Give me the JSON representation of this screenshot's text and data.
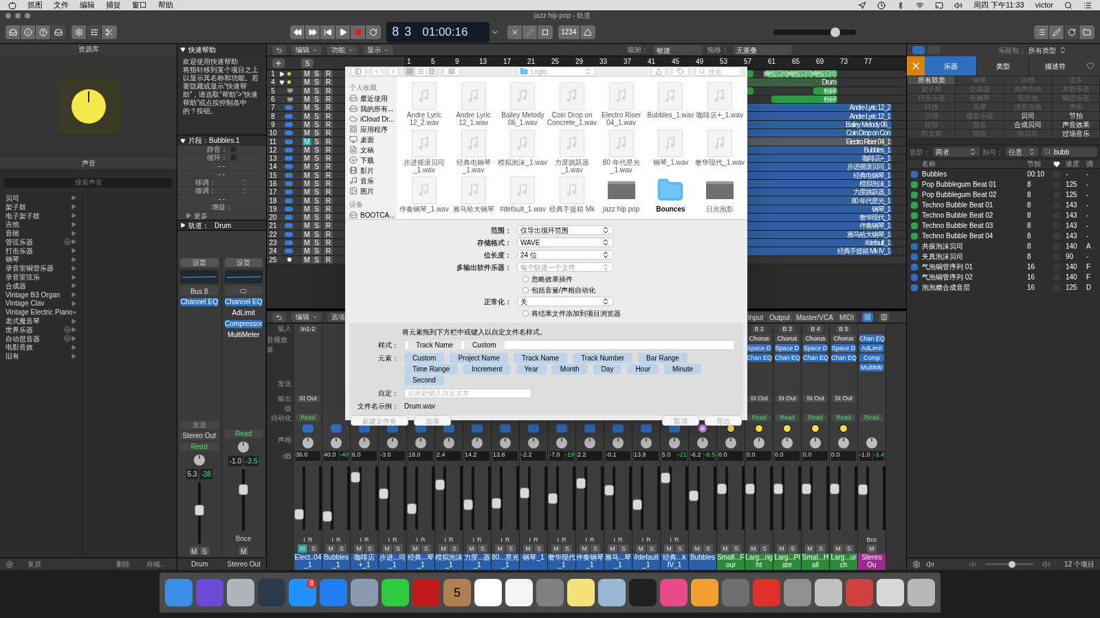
{
  "menu_bar": {
    "items": [
      "抓图",
      "文件",
      "编辑",
      "捕捉",
      "窗口",
      "帮助"
    ],
    "clock": "周四 下午11:33",
    "user": "victor"
  },
  "window": {
    "title": "jazz hip pop - 轨道"
  },
  "transport": {
    "bar": "8",
    "beat": "3",
    "time": "01:00:16",
    "count_in": "1234"
  },
  "zoom_slider": {
    "level": 0.75
  },
  "library": {
    "title": "资源库",
    "section": "声音",
    "search_placeholder": "搜索声音",
    "categories": [
      {
        "label": "贝司",
        "download": false
      },
      {
        "label": "架子鼓",
        "download": false
      },
      {
        "label": "电子架子鼓",
        "download": false
      },
      {
        "label": "吉他",
        "download": false
      },
      {
        "label": "音槌",
        "download": false
      },
      {
        "label": "管弦乐器",
        "download": true
      },
      {
        "label": "打击乐器",
        "download": false
      },
      {
        "label": "钢琴",
        "download": false
      },
      {
        "label": "录音室铜管乐器",
        "download": false
      },
      {
        "label": "录音室弦乐",
        "download": false
      },
      {
        "label": "合成器",
        "download": false
      },
      {
        "label": "Vintage B3 Organ",
        "download": false
      },
      {
        "label": "Vintage Clav",
        "download": false
      },
      {
        "label": "Vintage Electric Piano",
        "download": false
      },
      {
        "label": "老式魔音琴",
        "download": false
      },
      {
        "label": "世界乐器",
        "download": true
      },
      {
        "label": "自动琶音器",
        "download": true
      },
      {
        "label": "电影音效",
        "download": false
      },
      {
        "label": "旧有",
        "download": false
      }
    ],
    "buttons": [
      "复原",
      "删除",
      "存储..."
    ]
  },
  "quick_help": {
    "title": "快速帮助",
    "heading": "欢迎使用快速帮助",
    "body": "将指针移到某个项目之上以显示其名称和功能。若要隐藏或显示“快速帮助”，请选取“帮助”>“快速帮助”或点按控制条中的？按钮。"
  },
  "region_inspector": {
    "title": "片段：Bubbles.1",
    "fields": [
      {
        "kind": "check",
        "label": "静音：",
        "checked": false
      },
      {
        "kind": "check",
        "label": "循环：",
        "checked": false
      },
      {
        "kind": "value",
        "value": "- -"
      },
      {
        "kind": "value",
        "value": "- -"
      },
      {
        "kind": "stepper",
        "label": "移调："
      },
      {
        "kind": "stepper",
        "label": "微调："
      },
      {
        "kind": "value",
        "value": "- -"
      },
      {
        "kind": "label",
        "label": "增益："
      }
    ],
    "more": "更多"
  },
  "track_inspector": {
    "title": "轨道：",
    "name": "Drum"
  },
  "inspector_strips": [
    {
      "setting": "设置",
      "input": "Bus 8",
      "plugins": [
        "Channel EQ"
      ],
      "send": "发送",
      "output": "Stereo Out",
      "automation": "Read",
      "db": "5.3",
      "peak": "-38",
      "level": 0.55,
      "mute_label": "M",
      "solo_label": "S",
      "name": "Drum"
    },
    {
      "setting": "设置",
      "plugins": [
        "Channel EQ",
        "AdLimit",
        "Compressor",
        "MultiMeter"
      ],
      "automation": "Read",
      "db": "-1.0",
      "peak": "-3.5",
      "level": 0.7,
      "bounce": "Bnce",
      "mute_label": "M",
      "name": "Stereo Out"
    }
  ],
  "tracks_toolbar": {
    "menus": [
      "编辑",
      "功能",
      "显示"
    ],
    "solo_label": "S",
    "snap_label": "吸附：",
    "snap": "敏捷",
    "drag_label": "拖移：",
    "drag": "无重叠"
  },
  "ruler": [
    "1",
    "5",
    "9",
    "13",
    "17",
    "21",
    "25",
    "29",
    "33",
    "37",
    "41",
    "45",
    "49",
    "53",
    "57",
    "61",
    "65",
    "69",
    "73",
    "77"
  ],
  "tracks": [
    {
      "number": "1",
      "kind": "stack",
      "expanded": false,
      "muted": false,
      "mute_label": "M",
      "solo_label": "S",
      "record_label": "R",
      "regions": [
        {
          "color": "#2e9a44"
        },
        {
          "name": "拇指贝司",
          "color": "#2e9a44"
        },
        {
          "name": "拇指贝司",
          "color": "#2e9a44"
        },
        {
          "name": "拇指贝司",
          "color": "#2e9a44"
        }
      ]
    },
    {
      "number": "4",
      "kind": "stack",
      "expanded": true,
      "muted": false,
      "mute_label": "M",
      "solo_label": "S",
      "record_label": "R",
      "regions": [
        {
          "name": "Drum",
          "color": "#3f5f45"
        }
      ]
    },
    {
      "number": "5",
      "kind": "drum",
      "muted": false,
      "mute_label": "M",
      "solo_label": "S",
      "record_label": "R",
      "regions": [
        {
          "color": "#2e9a44"
        },
        {
          "name": "粉碎",
          "color": "#2e9a44"
        }
      ]
    },
    {
      "number": "6",
      "kind": "drum",
      "muted": false,
      "mute_label": "M",
      "solo_label": "S",
      "record_label": "R",
      "regions": [
        {
          "name": "粉碎",
          "color": "#2e9a44"
        }
      ]
    },
    {
      "number": "7",
      "kind": "audio",
      "muted": false,
      "mute_label": "M",
      "solo_label": "S",
      "record_label": "R",
      "regions": [
        {
          "name": "Andre Lyric 12_2",
          "color": "#2f5f9e"
        }
      ]
    },
    {
      "number": "8",
      "kind": "audio",
      "muted": false,
      "mute_label": "M",
      "solo_label": "S",
      "record_label": "R",
      "regions": [
        {
          "name": "Andre Lyric 12_1",
          "color": "#2f5f9e"
        }
      ]
    },
    {
      "number": "9",
      "kind": "audio",
      "muted": false,
      "mute_label": "M",
      "solo_label": "S",
      "record_label": "R",
      "regions": [
        {
          "name": "Bailey Melody 06_",
          "color": "#2f5f9e"
        }
      ]
    },
    {
      "number": "10",
      "kind": "audio",
      "muted": false,
      "mute_label": "M",
      "solo_label": "S",
      "record_label": "R",
      "regions": [
        {
          "name": "Coin Drop on Con",
          "color": "#2f5f9e"
        }
      ]
    },
    {
      "number": "11",
      "kind": "audio",
      "muted": true,
      "mute_label": "M",
      "solo_label": "S",
      "record_label": "R",
      "regions": [
        {
          "name": "Electro Riser 04_1",
          "color": "#555a60"
        }
      ]
    },
    {
      "number": "12",
      "kind": "audio",
      "muted": false,
      "mute_label": "M",
      "solo_label": "S",
      "record_label": "R",
      "regions": [
        {
          "name": "Bubbles_1",
          "color": "#2f5f9e"
        }
      ]
    },
    {
      "number": "13",
      "kind": "audio",
      "muted": false,
      "mute_label": "M",
      "solo_label": "S",
      "record_label": "R",
      "regions": [
        {
          "name": "咖啡店+_1",
          "color": "#2f5f9e"
        }
      ]
    },
    {
      "number": "14",
      "kind": "audio",
      "muted": false,
      "mute_label": "M",
      "solo_label": "S",
      "record_label": "R",
      "regions": [
        {
          "name": "步进摇滚贝司_1",
          "color": "#2f5f9e"
        }
      ]
    },
    {
      "number": "15",
      "kind": "audio",
      "muted": false,
      "mute_label": "M",
      "solo_label": "S",
      "record_label": "R",
      "regions": [
        {
          "name": "经典电钢琴_1",
          "color": "#2f5f9e"
        }
      ]
    },
    {
      "number": "16",
      "kind": "audio",
      "muted": false,
      "mute_label": "M",
      "solo_label": "S",
      "record_label": "R",
      "regions": [
        {
          "name": "模拟泡沫_1",
          "color": "#2f5f9e"
        }
      ]
    },
    {
      "number": "17",
      "kind": "audio",
      "muted": false,
      "mute_label": "M",
      "solo_label": "S",
      "record_label": "R",
      "regions": [
        {
          "name": "力度跳跃器_1",
          "color": "#2f5f9e"
        }
      ]
    },
    {
      "number": "18",
      "kind": "audio",
      "muted": false,
      "mute_label": "M",
      "solo_label": "S",
      "record_label": "R",
      "regions": [
        {
          "name": "80 年代星光_1",
          "color": "#2f5f9e"
        }
      ]
    },
    {
      "number": "19",
      "kind": "audio",
      "muted": false,
      "mute_label": "M",
      "solo_label": "S",
      "record_label": "R",
      "regions": [
        {
          "name": "钢琴_1",
          "color": "#2f5f9e"
        }
      ]
    },
    {
      "number": "20",
      "kind": "audio",
      "muted": false,
      "mute_label": "M",
      "solo_label": "S",
      "record_label": "R",
      "regions": [
        {
          "name": "奢华现代_1",
          "color": "#2f5f9e"
        }
      ]
    },
    {
      "number": "21",
      "kind": "audio",
      "muted": false,
      "mute_label": "M",
      "solo_label": "S",
      "record_label": "R",
      "regions": [
        {
          "name": "伴奏钢琴_1",
          "color": "#2f5f9e"
        }
      ]
    },
    {
      "number": "22",
      "kind": "audio",
      "muted": false,
      "mute_label": "M",
      "solo_label": "S",
      "record_label": "R",
      "regions": [
        {
          "name": "雅马哈大钢琴_1",
          "color": "#2f5f9e"
        }
      ]
    },
    {
      "number": "23",
      "kind": "audio",
      "muted": false,
      "mute_label": "M",
      "solo_label": "S",
      "record_label": "R",
      "regions": [
        {
          "name": "#default_1",
          "color": "#2f5f9e"
        }
      ]
    },
    {
      "number": "24",
      "kind": "audio",
      "muted": false,
      "mute_label": "M",
      "solo_label": "S",
      "record_label": "R",
      "regions": [
        {
          "name": "经典手提箱 Mk IV_1",
          "color": "#2f5f9e"
        }
      ]
    },
    {
      "number": "25",
      "kind": "instrument",
      "muted": false,
      "mute_label": "M",
      "solo_label": "S",
      "record_label": "R"
    }
  ],
  "mixer": {
    "menus": [
      "编辑",
      "选项"
    ],
    "tabs": [
      {
        "label": "Input",
        "selected": false
      },
      {
        "label": "Output",
        "selected": false
      },
      {
        "label": "Master/VCA",
        "selected": false
      },
      {
        "label": "MIDI",
        "selected": false
      }
    ],
    "row_labels": [
      "输入",
      "音频效果",
      "发送",
      "输出",
      "组",
      "自动化",
      "声相",
      "dB"
    ],
    "strips": [
      {
        "kind": "audio",
        "name": "Elect..04_1",
        "color": "#2a5ea8",
        "input": "In1-2",
        "output": "St Out",
        "automation": "Read",
        "db": "36.0",
        "level": 0.2,
        "muted": true,
        "input_label": "I",
        "record_label": "R",
        "mute_label": "M",
        "solo_label": "S"
      },
      {
        "kind": "audio",
        "name": "Bubbles_1",
        "color": "#2a5ea8",
        "db": "40.0",
        "peak": "-40",
        "level": 0.15,
        "muted": false,
        "input_label": "I",
        "record_label": "R",
        "mute_label": "M",
        "solo_label": "S"
      },
      {
        "kind": "audio",
        "name": "咖啡店+_1",
        "color": "#2a5ea8",
        "db": "6.0",
        "level": 0.9,
        "muted": false,
        "input_label": "I",
        "record_label": "R",
        "mute_label": "M",
        "solo_label": "S"
      },
      {
        "kind": "audio",
        "name": "步进...司_1",
        "color": "#2a5ea8",
        "db": "-3.0",
        "level": 0.58,
        "muted": false,
        "input_label": "I",
        "record_label": "R",
        "mute_label": "M",
        "solo_label": "S"
      },
      {
        "kind": "audio",
        "name": "经典...琴_1",
        "color": "#2a5ea8",
        "db": "18.0",
        "level": 0.3,
        "muted": false,
        "input_label": "I",
        "record_label": "R",
        "mute_label": "M",
        "solo_label": "S"
      },
      {
        "kind": "audio",
        "name": "模拟泡沫_1",
        "color": "#2a5ea8",
        "db": "2.4",
        "level": 0.75,
        "muted": false,
        "input_label": "I",
        "record_label": "R",
        "mute_label": "M",
        "solo_label": "S"
      },
      {
        "kind": "audio",
        "name": "力度...器_1",
        "color": "#2a5ea8",
        "db": "14.2",
        "level": 0.38,
        "muted": false,
        "input_label": "I",
        "record_label": "R",
        "mute_label": "M",
        "solo_label": "S"
      },
      {
        "kind": "audio",
        "name": "80...星光_1",
        "color": "#2a5ea8",
        "db": "13.8",
        "level": 0.4,
        "muted": false,
        "input_label": "I",
        "record_label": "R",
        "mute_label": "M",
        "solo_label": "S"
      },
      {
        "kind": "audio",
        "name": "钢琴_1",
        "color": "#2a5ea8",
        "db": "-2.2",
        "level": 0.6,
        "muted": false,
        "input_label": "I",
        "record_label": "R",
        "mute_label": "M",
        "solo_label": "S"
      },
      {
        "kind": "audio",
        "name": "奢华现代_1",
        "color": "#2a5ea8",
        "db": "-7.0",
        "peak": "-19",
        "level": 0.5,
        "muted": false,
        "input_label": "I",
        "record_label": "R",
        "mute_label": "M",
        "solo_label": "S"
      },
      {
        "kind": "audio",
        "name": "伴奏钢琴_1",
        "color": "#2a5ea8",
        "db": "2.2",
        "level": 0.78,
        "muted": false,
        "input_label": "I",
        "record_label": "R",
        "mute_label": "M",
        "solo_label": "S"
      },
      {
        "kind": "audio",
        "name": "雅马...琴_1",
        "color": "#2a5ea8",
        "db": "-0.1",
        "level": 0.65,
        "muted": false,
        "input_label": "I",
        "record_label": "R",
        "mute_label": "M",
        "solo_label": "S"
      },
      {
        "kind": "audio",
        "name": "#default_1",
        "color": "#2a5ea8",
        "db": "13.8",
        "level": 0.38,
        "muted": false,
        "input_label": "I",
        "record_label": "R",
        "mute_label": "M",
        "solo_label": "S"
      },
      {
        "kind": "audio",
        "name": "经典...k IV_1",
        "color": "#2a5ea8",
        "db": "5.0",
        "peak": "-21",
        "level": 0.88,
        "muted": false,
        "input_label": "I",
        "record_label": "R",
        "mute_label": "M",
        "solo_label": "S"
      },
      {
        "kind": "instrument",
        "name": "Bubbles",
        "color": "#2a5ea8",
        "db": "-6.2",
        "peak": "-6.5",
        "level": 0.55,
        "muted": false,
        "mute_label": "M",
        "solo_label": "S"
      },
      {
        "kind": "aux",
        "name": "Small...Four",
        "color": "#2d8a3a",
        "db": "0.0",
        "level": 0.68,
        "muted": false,
        "mute_label": "M",
        "solo_label": "S"
      },
      {
        "kind": "aux",
        "name": "Larg...right",
        "color": "#2d8a3a",
        "input": "B 2",
        "plugins": [
          "Chorus",
          "Space D",
          "Chan EQ"
        ],
        "output": "St Out",
        "automation": "Read",
        "db": "0.0",
        "level": 0.68,
        "muted": false,
        "mute_label": "M",
        "solo_label": "S"
      },
      {
        "kind": "aux",
        "name": "Larg...Plate",
        "color": "#2d8a3a",
        "input": "B 3",
        "plugins": [
          "Chorus",
          "Space D",
          "Chan EQ"
        ],
        "output": "St Out",
        "automation": "Read",
        "db": "0.0",
        "level": 0.68,
        "muted": false,
        "mute_label": "M",
        "solo_label": "S"
      },
      {
        "kind": "aux",
        "name": "Smal...Hall",
        "color": "#2d8a3a",
        "input": "B 4",
        "plugins": [
          "Chorus",
          "Space D",
          "Chan EQ"
        ],
        "output": "St Out",
        "automation": "Read",
        "db": "0.0",
        "level": 0.68,
        "muted": false,
        "mute_label": "M",
        "solo_label": "S"
      },
      {
        "kind": "aux",
        "name": "Larg...urch",
        "color": "#2d8a3a",
        "input": "B 5",
        "plugins": [
          "Chorus",
          "Space D",
          "Chan EQ"
        ],
        "output": "St Out",
        "automation": "Read",
        "db": "0.0",
        "level": 0.68,
        "muted": false,
        "mute_label": "M",
        "solo_label": "S"
      },
      {
        "kind": "master",
        "name": "Stereo Ou",
        "color": "#9a2a8e",
        "plugins": [
          "Chan EQ",
          "AdLimit",
          "Comp",
          "MultiMtr"
        ],
        "automation": "Read",
        "db": "-1.0",
        "peak": "-3.4",
        "level": 0.66,
        "muted": false,
        "bounce": "Bnc",
        "mute_label": "M"
      }
    ]
  },
  "export_dialog": {
    "location": "Logic",
    "search_placeholder": "搜索",
    "sidebar": [
      {
        "heading": "个人收藏",
        "items": [
          {
            "label": "最近使用",
            "kind": "drive"
          },
          {
            "label": "我的所有...",
            "kind": "drive"
          },
          {
            "label": "iCloud Dr...",
            "kind": "cloud"
          },
          {
            "label": "应用程序",
            "kind": "apps"
          },
          {
            "label": "桌面",
            "kind": "desktop"
          },
          {
            "label": "文稿",
            "kind": "docs"
          },
          {
            "label": "下载",
            "kind": "download"
          },
          {
            "label": "影片",
            "kind": "film"
          },
          {
            "label": "音乐",
            "kind": "music"
          },
          {
            "label": "图片",
            "kind": "photo"
          }
        ]
      },
      {
        "heading": "设备",
        "items": [
          {
            "label": "BOOTCA...",
            "kind": "drive"
          }
        ]
      }
    ],
    "files": [
      {
        "name": "Andre Lyric 12_2.wav",
        "kind": "audio"
      },
      {
        "name": "Andre Lyric 12_1.wav",
        "kind": "audio"
      },
      {
        "name": "Bailey Melody 06_1.wav",
        "kind": "audio"
      },
      {
        "name": "Coin Drop on Concrete_1.wav",
        "kind": "audio"
      },
      {
        "name": "Electro Riser 04_1.wav",
        "kind": "audio"
      },
      {
        "name": "Bubbles_1.wav",
        "kind": "audio"
      },
      {
        "name": "咖啡店+_1.wav",
        "kind": "audio"
      },
      {
        "name": "步进摇滚贝司_1.wav",
        "kind": "audio"
      },
      {
        "name": "经典电钢琴_1.wav",
        "kind": "audio"
      },
      {
        "name": "模拟泡沫_1.wav",
        "kind": "audio"
      },
      {
        "name": "力度跳跃器_1.wav",
        "kind": "audio"
      },
      {
        "name": "80 年代星光_1.wav",
        "kind": "audio"
      },
      {
        "name": "钢琴_1.wav",
        "kind": "audio"
      },
      {
        "name": "奢华现代_1.wav",
        "kind": "audio"
      },
      {
        "name": "伴奏钢琴_1.wav",
        "kind": "audio"
      },
      {
        "name": "雅马哈大钢琴",
        "kind": "audio"
      },
      {
        "name": "#default_1.wav",
        "kind": "audio"
      },
      {
        "name": "经典手提箱 Mk",
        "kind": "audio"
      },
      {
        "name": "jazz hip pop",
        "kind": "project"
      },
      {
        "name": "Bounces",
        "kind": "folder"
      },
      {
        "name": "日光泡影",
        "kind": "project"
      }
    ],
    "options": [
      {
        "kind": "select",
        "label": "范围：",
        "value": "仅导出循环范围",
        "disabled": false
      },
      {
        "kind": "select",
        "label": "存储格式：",
        "value": "WAVE",
        "disabled": false
      },
      {
        "kind": "select",
        "label": "位长度：",
        "value": "24 位",
        "disabled": false
      },
      {
        "kind": "select",
        "label": "多输出软件乐器：",
        "value": "每个轨道一个文件",
        "disabled": true
      },
      {
        "kind": "check",
        "label": "忽略效果插件",
        "checked": false
      },
      {
        "kind": "check",
        "label": "包括音量/声相自动化",
        "checked": false
      },
      {
        "kind": "select",
        "label": "正常化：",
        "value": "关",
        "disabled": false
      },
      {
        "kind": "check",
        "label": "将结果文件添加到项目浏览器",
        "checked": false
      }
    ],
    "naming": {
      "hint": "将元素拖到下方栏中或键入以自定文件名样式。",
      "style_label": "样式：",
      "style_tokens": [
        "Track Name",
        "Custom"
      ],
      "elements_label": "元素：",
      "elements": [
        "Custom",
        "Project Name",
        "Track Name",
        "Track Number",
        "Bar Range",
        "Time Range",
        "Increment",
        "Year",
        "Month",
        "Day",
        "Hour",
        "Minute",
        "Second"
      ],
      "custom_label": "自定：",
      "custom_placeholder": "在此处键入自定文本",
      "example_label": "文件名示例：",
      "example": "Drum.wav"
    },
    "buttons": [
      {
        "label": "新建文件夹",
        "disabled": true
      },
      {
        "label": "选项",
        "disabled": true
      },
      {
        "label": "取消",
        "disabled": true
      },
      {
        "label": "导出",
        "disabled": true
      }
    ]
  },
  "loop_browser": {
    "pack_label": "乐段包：",
    "pack": "所有类型",
    "tabs": [
      {
        "label": "乐器",
        "selected": true
      },
      {
        "label": "类型",
        "selected": false
      },
      {
        "label": "描述符",
        "selected": false
      }
    ],
    "keywords": [
      {
        "label": "所有鼓类",
        "disabled": false,
        "selected": true
      },
      {
        "label": "钢琴",
        "disabled": true,
        "selected": false
      },
      {
        "label": "吉他",
        "disabled": true,
        "selected": false
      },
      {
        "label": "弦乐",
        "disabled": true,
        "selected": false
      },
      {
        "label": "架子鼓",
        "disabled": true,
        "selected": false
      },
      {
        "label": "合成器",
        "disabled": true,
        "selected": false
      },
      {
        "label": "原声吉他",
        "disabled": true,
        "selected": false
      },
      {
        "label": "木管乐器",
        "disabled": true,
        "selected": false
      },
      {
        "label": "打击乐器",
        "disabled": true,
        "selected": false
      },
      {
        "label": "电钢琴",
        "disabled": true,
        "selected": false
      },
      {
        "label": "电吉他",
        "disabled": true,
        "selected": false
      },
      {
        "label": "铜管乐器",
        "disabled": true,
        "selected": false
      },
      {
        "label": "特效",
        "disabled": true,
        "selected": false
      },
      {
        "label": "风琴",
        "disabled": true,
        "selected": false
      },
      {
        "label": "清音吉他",
        "disabled": true,
        "selected": false
      },
      {
        "label": "声乐",
        "disabled": true,
        "selected": false
      },
      {
        "label": "沙锤",
        "disabled": true,
        "selected": false
      },
      {
        "label": "键盘乐器",
        "disabled": true,
        "selected": false
      },
      {
        "label": "贝司",
        "disabled": false,
        "selected": false
      },
      {
        "label": "节拍",
        "disabled": false,
        "selected": false
      },
      {
        "label": "铃鼓",
        "disabled": true,
        "selected": false
      },
      {
        "label": "颤音",
        "disabled": true,
        "selected": false
      },
      {
        "label": "合成贝司",
        "disabled": false,
        "selected": false
      },
      {
        "label": "声音效果",
        "disabled": false,
        "selected": false
      },
      {
        "label": "邦戈鼓",
        "disabled": true,
        "selected": false
      },
      {
        "label": "鼓组",
        "disabled": true,
        "selected": false
      },
      {
        "label": "电贝司",
        "disabled": true,
        "selected": false
      },
      {
        "label": "过场音乐",
        "disabled": false,
        "selected": false
      }
    ],
    "scale_label": "音阶：",
    "scale": "两者",
    "signature_label": "拍号：",
    "signature": "任意",
    "search": "bubb",
    "columns": [
      "名称",
      "节拍",
      "速度",
      "调"
    ],
    "rows": [
      {
        "kind": "audio",
        "name": "Bubbles",
        "beats": "00:10",
        "tempo": "-",
        "key": "-",
        "favorite": false
      },
      {
        "kind": "midi",
        "name": "Pop Bubblegum Beat 01",
        "beats": "8",
        "tempo": "125",
        "key": "-",
        "favorite": false
      },
      {
        "kind": "midi",
        "name": "Pop Bubblegum Beat 02",
        "beats": "8",
        "tempo": "125",
        "key": "-",
        "favorite": false
      },
      {
        "kind": "midi",
        "name": "Techno Bubble Beat 01",
        "beats": "8",
        "tempo": "143",
        "key": "-",
        "favorite": false
      },
      {
        "kind": "midi",
        "name": "Techno Bubble Beat 02",
        "beats": "8",
        "tempo": "143",
        "key": "-",
        "favorite": false
      },
      {
        "kind": "midi",
        "name": "Techno Bubble Beat 03",
        "beats": "8",
        "tempo": "143",
        "key": "-",
        "favorite": false
      },
      {
        "kind": "midi",
        "name": "Techno Bubble Beat 04",
        "beats": "8",
        "tempo": "143",
        "key": "-",
        "favorite": false
      },
      {
        "kind": "audio",
        "name": "共振泡沫贝司",
        "beats": "8",
        "tempo": "140",
        "key": "A",
        "favorite": false
      },
      {
        "kind": "audio",
        "name": "失真泡沫贝司",
        "beats": "8",
        "tempo": "90",
        "key": "-",
        "favorite": false
      },
      {
        "kind": "audio",
        "name": "气泡铜管序列 01",
        "beats": "16",
        "tempo": "140",
        "key": "F",
        "favorite": false
      },
      {
        "kind": "audio",
        "name": "气泡铜管序列 02",
        "beats": "16",
        "tempo": "140",
        "key": "F",
        "favorite": false
      },
      {
        "kind": "audio",
        "name": "泡泡糖合成音层",
        "beats": "16",
        "tempo": "125",
        "key": "D",
        "favorite": false
      }
    ],
    "count": "12 个项目",
    "volume": {
      "level": 0.55
    }
  },
  "dock": {
    "badge": "8",
    "calendar_day": "5"
  }
}
